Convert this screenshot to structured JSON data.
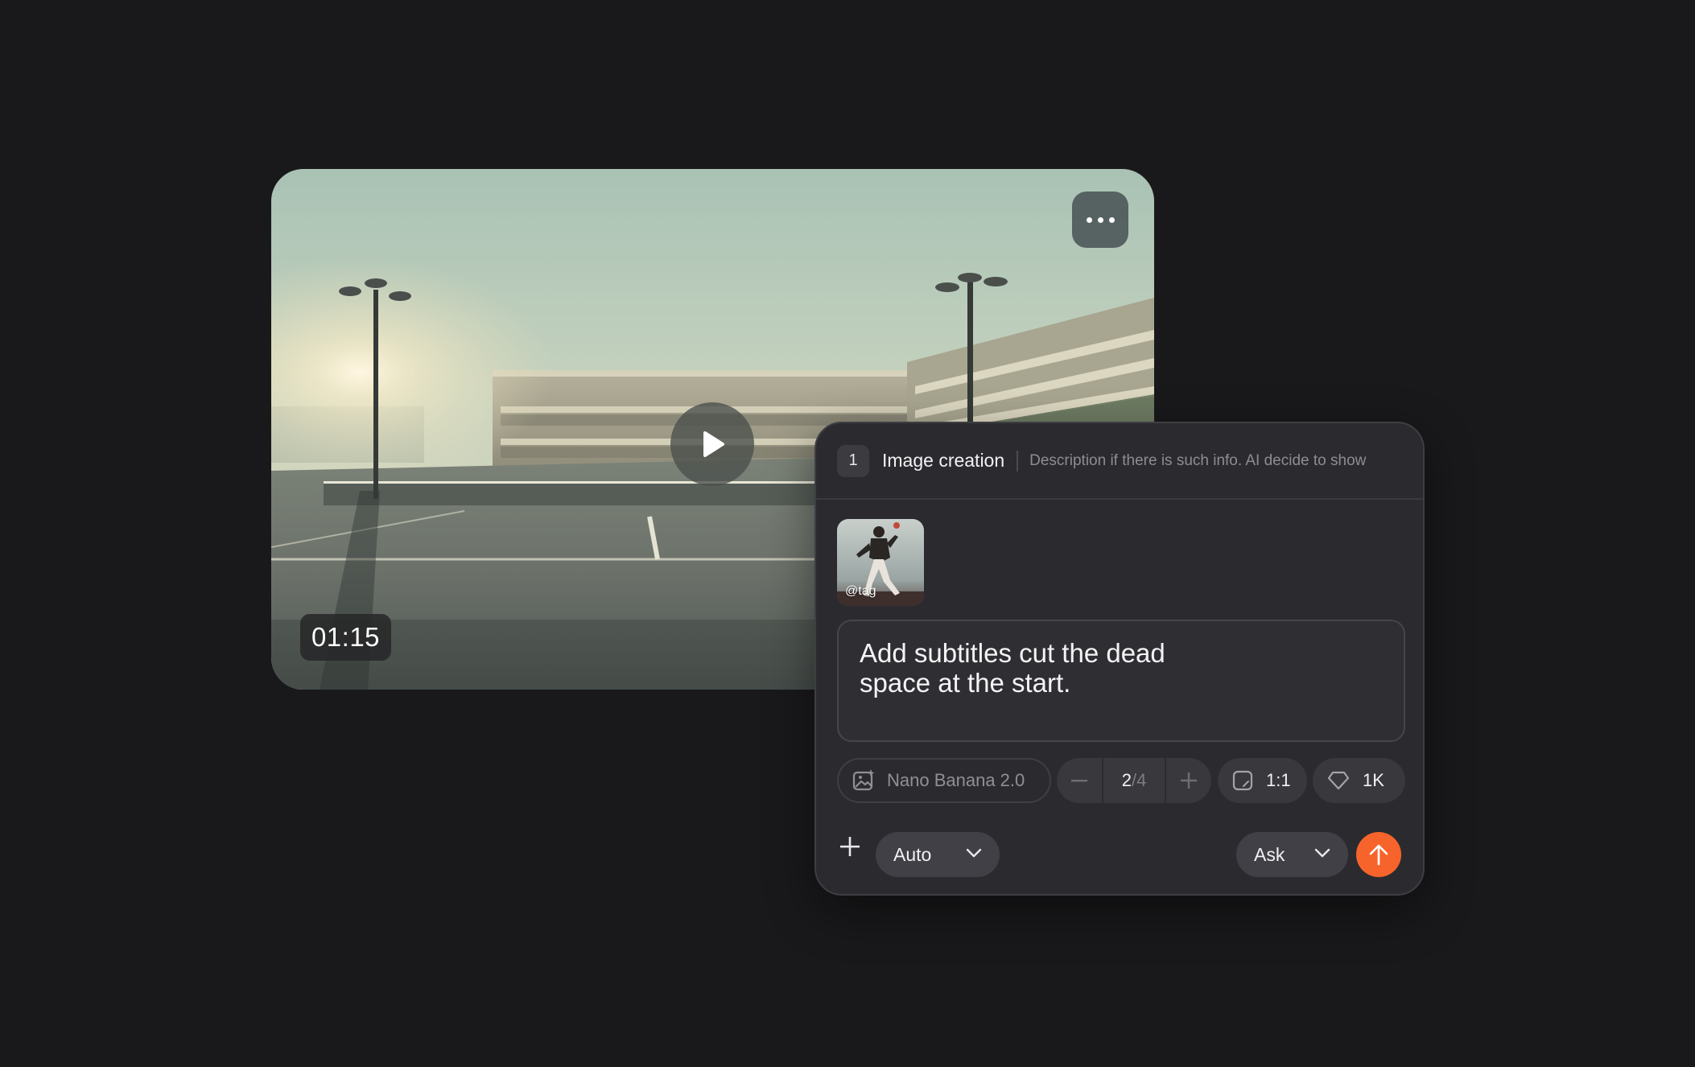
{
  "video": {
    "duration": "01:15",
    "more_icon": "more-horizontal-icon",
    "play_icon": "play-icon"
  },
  "panel": {
    "step_number": "1",
    "title": "Image creation",
    "description": "Description if there is such info. AI decide to show",
    "attachment": {
      "tag": "@tag"
    },
    "prompt": "Add subtitles cut the dead\nspace at the start.",
    "options": {
      "model": "Nano Banana 2.0",
      "count_current": "2",
      "count_separator": "/",
      "count_total": "4",
      "ratio": "1:1",
      "resolution": "1K"
    },
    "mode": "Auto",
    "action": "Ask",
    "colors": {
      "accent": "#f6642b"
    }
  }
}
